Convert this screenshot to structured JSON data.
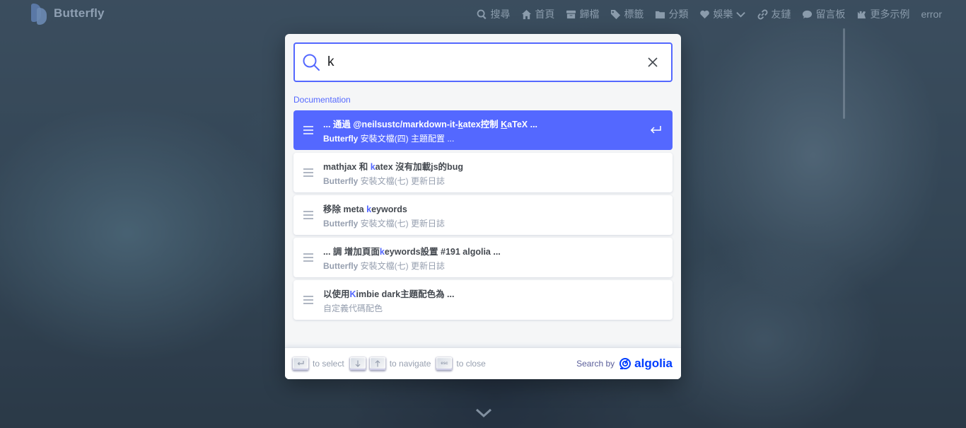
{
  "navbar": {
    "brand": "Butterfly",
    "menu": [
      {
        "icon": "search-icon",
        "label": "搜尋"
      },
      {
        "icon": "home-icon",
        "label": "首頁"
      },
      {
        "icon": "archive-icon",
        "label": "歸檔"
      },
      {
        "icon": "tag-icon",
        "label": "標籤"
      },
      {
        "icon": "folder-icon",
        "label": "分類"
      },
      {
        "icon": "heart-icon",
        "label": "娛樂"
      },
      {
        "icon": "link-icon",
        "label": "友鏈"
      },
      {
        "icon": "comment-icon",
        "label": "留言板"
      },
      {
        "icon": "fish-icon",
        "label": "更多示例"
      },
      {
        "label": "error"
      }
    ]
  },
  "search": {
    "query": "k"
  },
  "results": {
    "source_title": "Documentation",
    "hits": [
      {
        "title_parts": [
          "... 通過 @neilsustc/markdown-it-",
          "k",
          "atex控制 ",
          "K",
          "aTeX ..."
        ],
        "path_bold": "Butterfly",
        "path_rest": " 安裝文檔(四) 主題配置 ...",
        "active": true
      },
      {
        "title_parts": [
          "mathjax 和 ",
          "k",
          "atex 沒有加載js的bug"
        ],
        "path_bold": "Butterfly",
        "path_rest": " 安裝文檔(七) 更新日誌",
        "active": false
      },
      {
        "title_parts": [
          "移除 meta ",
          "k",
          "eywords"
        ],
        "path_bold": "Butterfly",
        "path_rest": " 安裝文檔(七) 更新日誌",
        "active": false
      },
      {
        "title_parts": [
          "... 調 增加頁面",
          "k",
          "eywords設置 #191 algolia ..."
        ],
        "path_bold": "Butterfly",
        "path_rest": " 安裝文檔(七) 更新日誌",
        "active": false
      },
      {
        "title_parts": [
          "以使用",
          "K",
          "imbie dark主題配色為 ..."
        ],
        "path_bold": "",
        "path_rest": "自定義代碼配色",
        "active": false
      }
    ]
  },
  "footer": {
    "select_label": "to select",
    "navigate_label": "to navigate",
    "close_label": "to close",
    "esc_key": "esc",
    "search_by": "Search by",
    "algolia": "algolia"
  },
  "colors": {
    "accent": "#5468ff",
    "algolia": "#003dff"
  }
}
